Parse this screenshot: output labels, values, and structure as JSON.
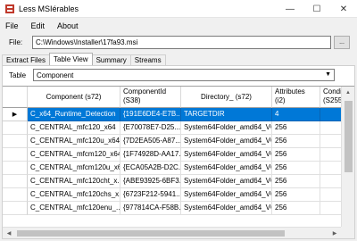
{
  "window": {
    "title": "Less MSIérables",
    "minimize": "—",
    "maximize": "☐",
    "close": "✕"
  },
  "menu": [
    "File",
    "Edit",
    "About"
  ],
  "file": {
    "label": "File:",
    "value": "C:\\Windows\\Installer\\17fa93.msi",
    "browse": "..."
  },
  "tabs": [
    "Extract Files",
    "Table View",
    "Summary",
    "Streams"
  ],
  "active_tab": "Table View",
  "table_selector": {
    "label": "Table",
    "value": "Component"
  },
  "grid": {
    "columns": [
      "Component (s72)",
      "ComponentId (S38)",
      "Directory_ (s72)",
      "Attributes (i2)",
      "Conditi (S255)"
    ],
    "rows": [
      [
        "C_x64_Runtime_Detection",
        "{191E6DE4-E7B...",
        "TARGETDIR",
        "4",
        ""
      ],
      [
        "C_CENTRAL_mfc120_x64",
        "{E70078E7-D25...",
        "System64Folder_amd64_VC",
        "256",
        ""
      ],
      [
        "C_CENTRAL_mfc120u_x64",
        "{7D2EA505-A87...",
        "System64Folder_amd64_VC",
        "256",
        ""
      ],
      [
        "C_CENTRAL_mfcm120_x64",
        "{1F74928D-AA17...",
        "System64Folder_amd64_VC",
        "256",
        ""
      ],
      [
        "C_CENTRAL_mfcm120u_x64",
        "{ECA05A2B-D2C...",
        "System64Folder_amd64_VC",
        "256",
        ""
      ],
      [
        "C_CENTRAL_mfc120cht_x...",
        "{ABE93925-6BF3...",
        "System64Folder_amd64_VC",
        "256",
        ""
      ],
      [
        "C_CENTRAL_mfc120chs_x...",
        "{6723F212-5941...",
        "System64Folder_amd64_VC",
        "256",
        ""
      ],
      [
        "C_CENTRAL_mfc120enu_...",
        "{977814CA-F58B...",
        "System64Folder_amd64_VC",
        "256",
        ""
      ]
    ],
    "selected_row": 0,
    "row_indicator": "▶"
  },
  "colors": {
    "selection": "#0078d7",
    "accent_icon": "#c0392b"
  },
  "icons": {
    "app": "app-icon",
    "dropdown": "chevron-down-icon"
  }
}
